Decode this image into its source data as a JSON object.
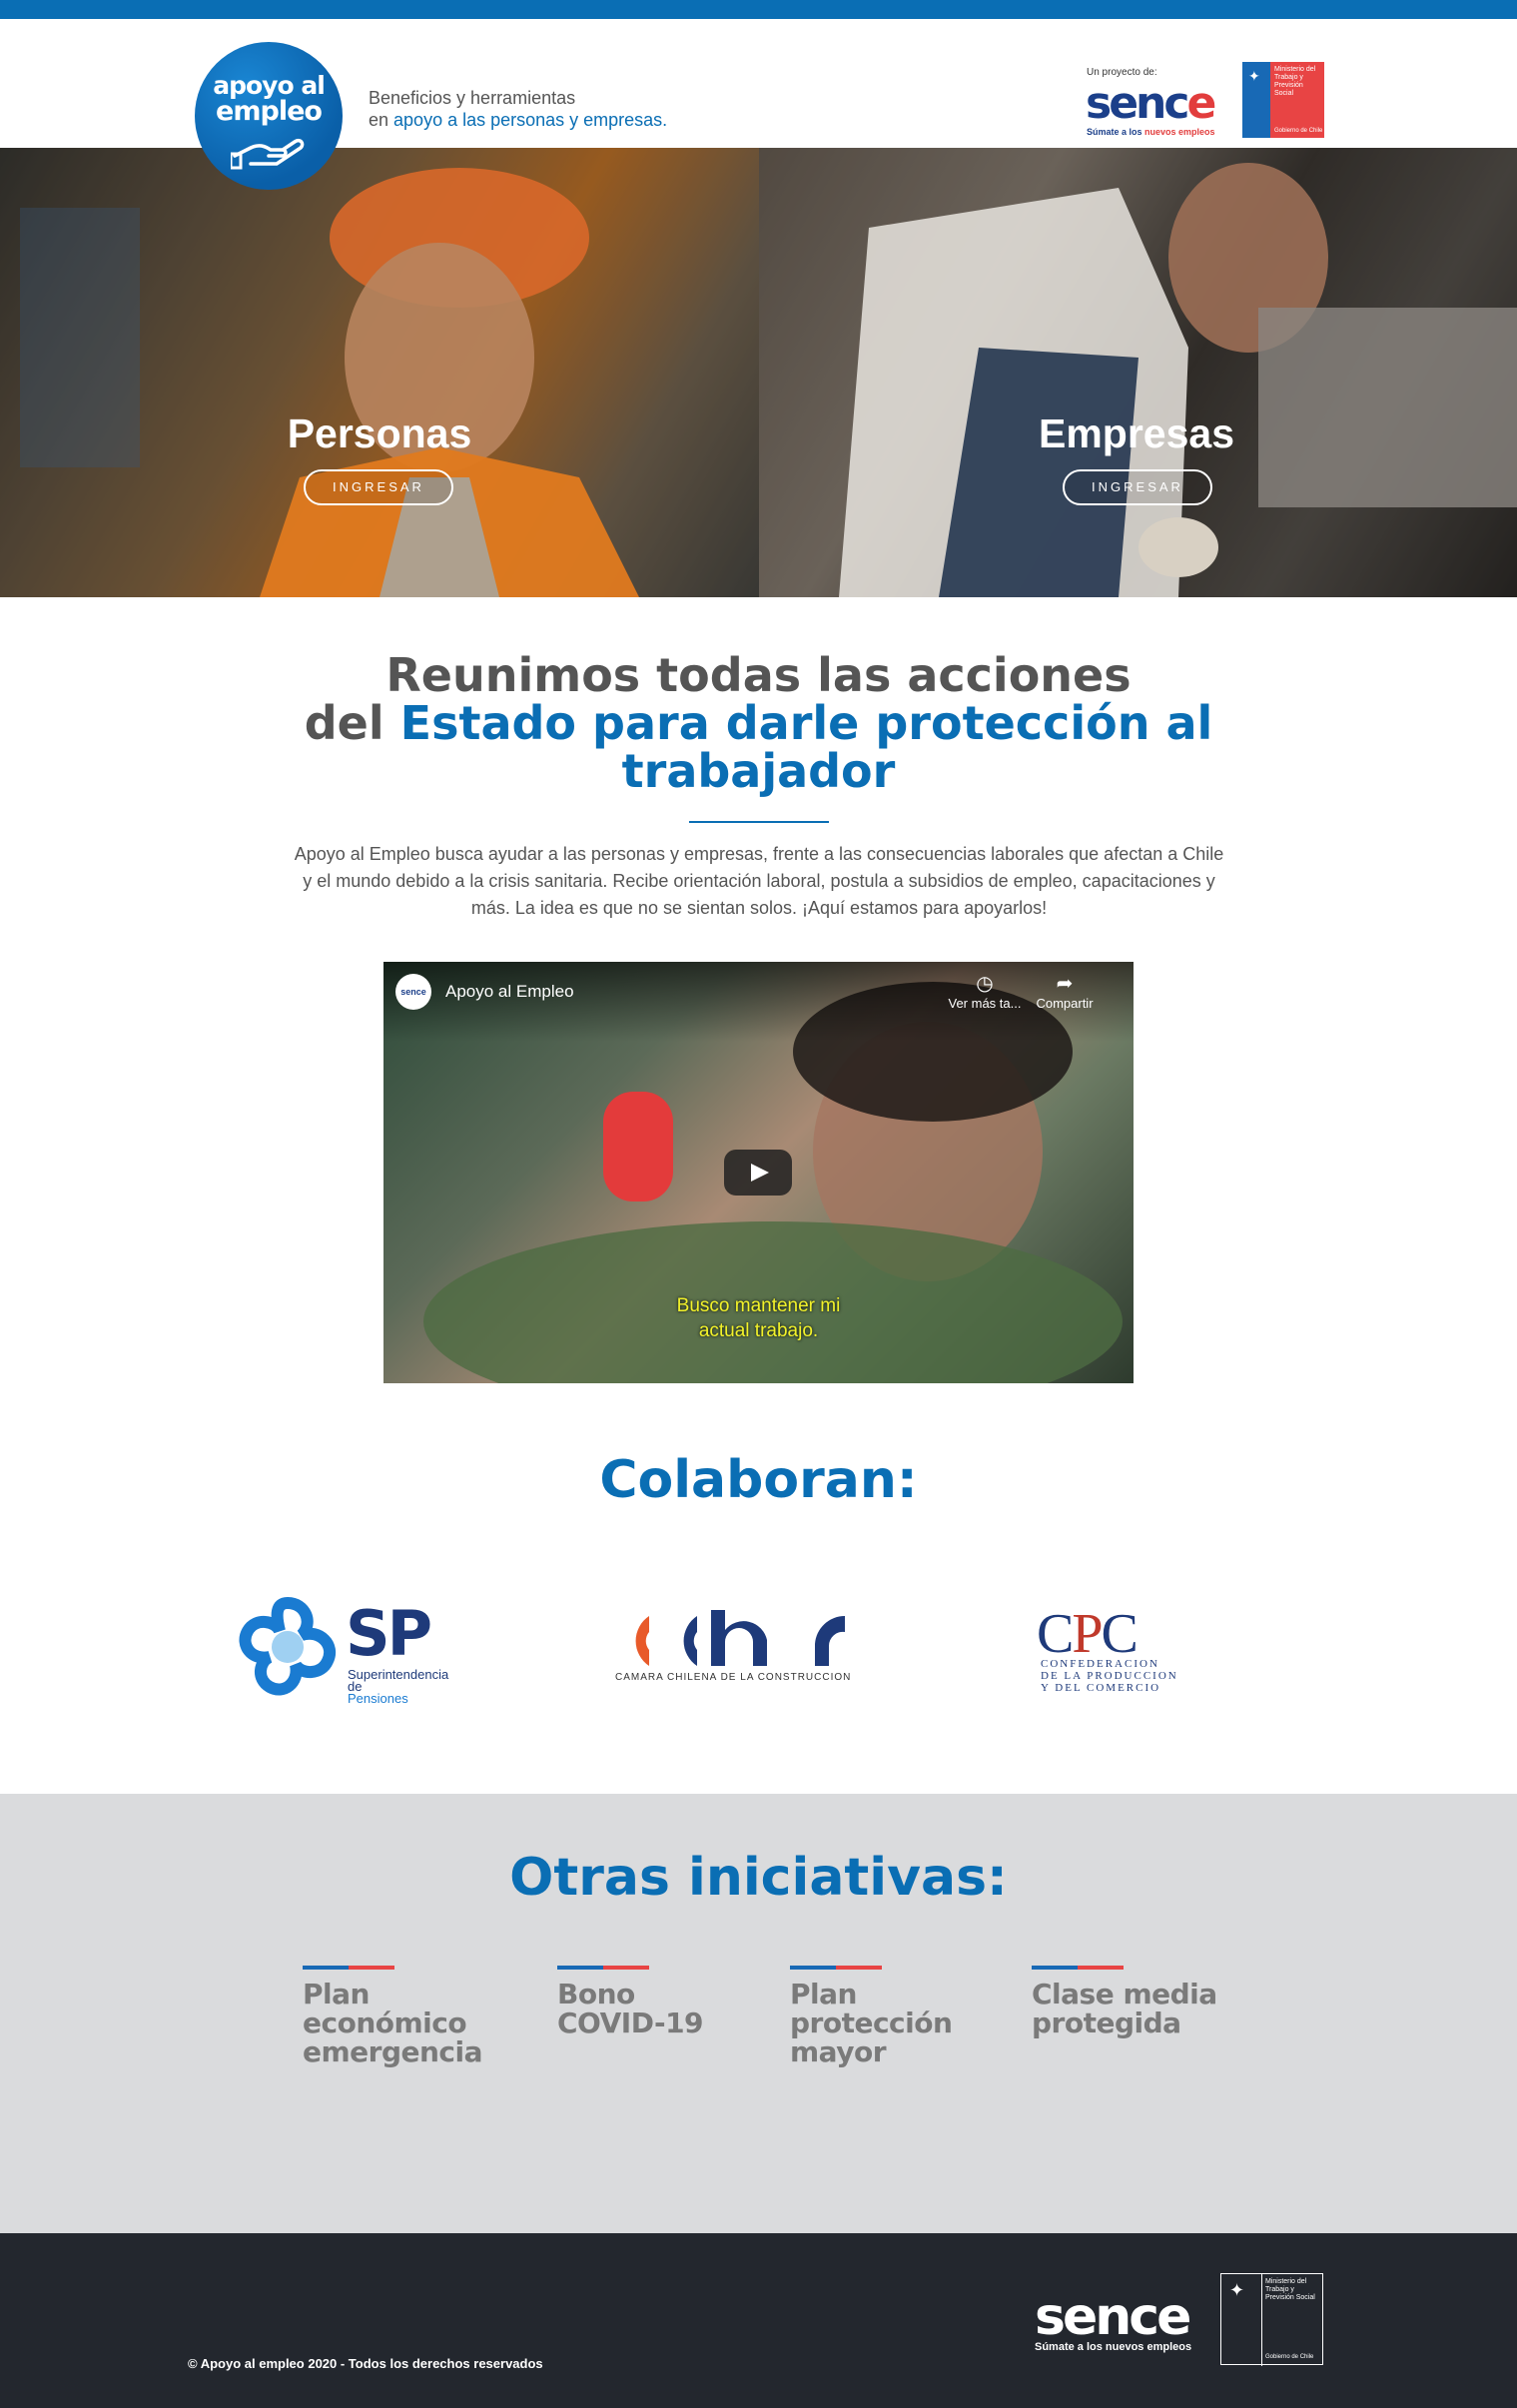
{
  "header": {
    "logo_line1": "apoyo al",
    "logo_line2": "empleo",
    "tagline_line1": "Beneficios y herramientas",
    "tagline_prefix": "en ",
    "tagline_highlight": "apoyo a las personas y empresas.",
    "project_label": "Un proyecto de:",
    "sence_word_main": "senc",
    "sence_word_e": "e",
    "sence_slogan_prefix": "Súmate a los ",
    "sence_slogan_highlight": "nuevos empleos",
    "ministerio_text": "Ministerio del Trabajo y Previsión Social",
    "gobierno_text": "Gobierno de Chile"
  },
  "hero": {
    "left": {
      "title": "Personas",
      "button": "INGRESAR"
    },
    "right": {
      "title": "Empresas",
      "button": "INGRESAR"
    }
  },
  "intro": {
    "heading_line1": "Reunimos todas las acciones",
    "heading_line2_prefix": "del ",
    "heading_line2_highlight": "Estado para darle protección al",
    "heading_line3": "trabajador",
    "paragraph": "Apoyo al Empleo busca ayudar a las personas y empresas, frente a las consecuencias laborales que afectan a Chile y el mundo debido a la crisis sanitaria. Recibe orientación laboral, postula a subsidios de empleo, capacitaciones y más. La idea es que no se sientan solos. ¡Aquí estamos para apoyarlos!"
  },
  "video": {
    "channel_avatar": "sence",
    "title": "Apoyo al Empleo",
    "watch_later": "Ver más ta...",
    "share": "Compartir",
    "subtitle_line1": "Busco mantener mi",
    "subtitle_line2": "actual trabajo."
  },
  "colaboran": {
    "heading": "Colaboran:",
    "sp_letters": "SP",
    "sp_text_line1": "Superintendencia de",
    "sp_text_line2": "Pensiones",
    "cchc_text": "CAMARA CHILENA DE LA CONSTRUCCION",
    "cpc_c1": "C",
    "cpc_p": "P",
    "cpc_c2": "C",
    "cpc_line1": "CONFEDERACION",
    "cpc_line2": "DE LA PRODUCCION",
    "cpc_line3": "Y DEL COMERCIO"
  },
  "otras": {
    "heading": "Otras iniciativas:",
    "items": [
      {
        "lines": [
          "Plan",
          "económico",
          "emergencia"
        ]
      },
      {
        "lines": [
          "Bono",
          "COVID-19"
        ]
      },
      {
        "lines": [
          "Plan",
          "protección",
          "mayor"
        ]
      },
      {
        "lines": [
          "Clase media",
          "protegida"
        ]
      }
    ]
  },
  "footer": {
    "copyright": "© Apoyo al empleo 2020 - Todos los derechos reservados",
    "sence_word": "sence",
    "sence_slogan": "Súmate a los nuevos empleos",
    "ministerio_text": "Ministerio del Trabajo y Previsión Social",
    "gobierno_text": "Gobierno de Chile"
  },
  "colors": {
    "brand_blue": "#0a6eb4",
    "navy": "#1b3f8a",
    "accent_red": "#e23d3d",
    "gray_section": "#dadbdd",
    "footer_bg": "#23272e"
  }
}
